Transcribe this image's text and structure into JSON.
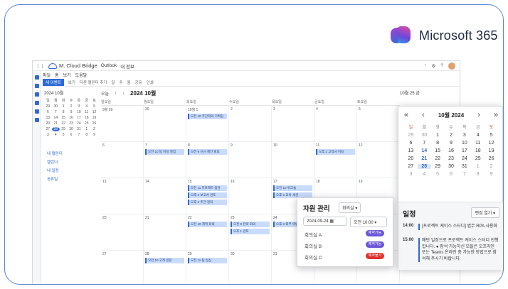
{
  "brand_badge": {
    "text": "Microsoft 365"
  },
  "app": {
    "title": "M. Cloud Bridge",
    "top_tabs": [
      "Outlook",
      "내 정보"
    ],
    "menu": [
      "파일",
      "홈",
      "보기",
      "도움말"
    ],
    "new_button": "새 이벤트",
    "ribbon_items": [
      "보기",
      "다른 캘린더 추가",
      "일",
      "주",
      "월",
      "공유",
      "인쇄"
    ],
    "mini_calendar": {
      "title": "2024 10월",
      "weekdays": [
        "일",
        "월",
        "화",
        "수",
        "목",
        "금",
        "토"
      ],
      "days": [
        "29",
        "30",
        "1",
        "2",
        "3",
        "4",
        "5",
        "6",
        "7",
        "8",
        "9",
        "10",
        "11",
        "12",
        "13",
        "14",
        "15",
        "16",
        "17",
        "18",
        "19",
        "20",
        "21",
        "22",
        "23",
        "24",
        "25",
        "26",
        "27",
        "28",
        "29",
        "30",
        "31",
        "1",
        "2",
        "3",
        "4",
        "5",
        "6",
        "7",
        "8",
        "9"
      ],
      "today": "28"
    },
    "side_links": [
      "내 캘린더",
      "캘린더",
      "내 일정",
      "공휴일"
    ],
    "main": {
      "today_btn": "오늘",
      "month_title": "2024 10월",
      "weekdays": [
        "일요일",
        "월요일",
        "화요일",
        "수요일",
        "목요일",
        "금요일",
        "토요일"
      ],
      "cells": [
        {
          "d": "9월 29",
          "ev": []
        },
        {
          "d": "30",
          "ev": []
        },
        {
          "d": "10월 1",
          "ev": [
            "오전 10 주간회의 기획팀"
          ]
        },
        {
          "d": "2",
          "ev": []
        },
        {
          "d": "3",
          "ev": []
        },
        {
          "d": "4",
          "ev": []
        },
        {
          "d": "5",
          "ev": []
        },
        {
          "d": "6",
          "ev": []
        },
        {
          "d": "7",
          "ev": [
            "오전 10 팀 미팅 영업"
          ]
        },
        {
          "d": "8",
          "ev": [
            "오전 9 신규 제안 회의"
          ]
        },
        {
          "d": "9",
          "ev": []
        },
        {
          "d": "10",
          "ev": []
        },
        {
          "d": "11",
          "ev": [
            "오후 2 고객사 미팅"
          ]
        },
        {
          "d": "12",
          "ev": []
        },
        {
          "d": "13",
          "ev": []
        },
        {
          "d": "14",
          "ev": []
        },
        {
          "d": "15",
          "ev": [
            "오전 11 프로젝트 점검",
            "오후 2 보고서 검토",
            "오후 4 주간 정리"
          ]
        },
        {
          "d": "16",
          "ev": []
        },
        {
          "d": "17",
          "ev": [
            "오전 10 워크숍",
            "오후 3 교육 세션"
          ]
        },
        {
          "d": "18",
          "ev": []
        },
        {
          "d": "19",
          "ev": []
        },
        {
          "d": "20",
          "ev": []
        },
        {
          "d": "21",
          "ev": []
        },
        {
          "d": "22",
          "ev": [
            "오전 10 계획 회의"
          ]
        },
        {
          "d": "23",
          "ev": [
            "오전 9 전략 회의",
            "오후 1 검토"
          ]
        },
        {
          "d": "24",
          "ev": [
            "오후 2 외부 미팅"
          ]
        },
        {
          "d": "25",
          "ev": []
        },
        {
          "d": "26",
          "ev": []
        },
        {
          "d": "27",
          "ev": []
        },
        {
          "d": "28",
          "ev": [
            "오전 10 고객 방문"
          ]
        },
        {
          "d": "29",
          "ev": [
            "오전 11 팀 점심"
          ]
        },
        {
          "d": "30",
          "ev": []
        },
        {
          "d": "31",
          "ev": []
        },
        {
          "d": "11월 1",
          "ev": []
        },
        {
          "d": "2",
          "ev": []
        }
      ]
    },
    "day_header": "10월 25 금"
  },
  "big_calendar": {
    "month_title": "10월 2024",
    "weekdays": [
      "일",
      "월",
      "화",
      "수",
      "목",
      "금",
      "토"
    ],
    "days": [
      "29",
      "30",
      "1",
      "2",
      "3",
      "4",
      "5",
      "6",
      "7",
      "8",
      "9",
      "10",
      "11",
      "12",
      "13",
      "14",
      "15",
      "16",
      "17",
      "18",
      "19",
      "20",
      "21",
      "22",
      "23",
      "24",
      "25",
      "26",
      "27",
      "28",
      "29",
      "30",
      "31",
      "1",
      "2",
      "3",
      "4",
      "5",
      "6",
      "7",
      "8",
      "9"
    ],
    "selected": "28",
    "schedule": {
      "title": "일정",
      "edit_button": "편집 열기",
      "items": [
        {
          "time": "14:00",
          "text": "[프로젝트 케이스 스터디] 법무 RPA 사용화"
        },
        {
          "time": "15:00",
          "text": "매번 일정으로 프로젝트 케이스 스터디 진행합니다. ● 참석 가능하신 모들은 오프라인 또는 Teams 온라인 중 가능한 방법으로 참석해 주시기 바랍니다."
        }
      ]
    }
  },
  "resource": {
    "title": "자원 관리",
    "type_select": "회의실",
    "date": "2024-09-24",
    "time_select": "오전 10:00",
    "rooms": [
      {
        "name": "회의실 A",
        "status": "예약가능",
        "color": "#6a56d8"
      },
      {
        "name": "회의실 B",
        "status": "예약가능",
        "color": "#6a56d8"
      },
      {
        "name": "회의실 C",
        "status": "예약불가",
        "color": "#e0312e"
      }
    ]
  }
}
